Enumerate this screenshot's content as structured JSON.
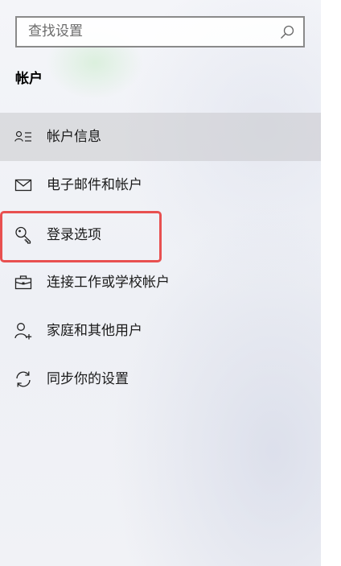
{
  "search": {
    "placeholder": "查找设置",
    "icon": "search-icon"
  },
  "section": {
    "title": "帐户"
  },
  "nav": {
    "items": [
      {
        "label": "帐户信息",
        "icon": "account-info-icon",
        "active": true
      },
      {
        "label": "电子邮件和帐户",
        "icon": "mail-icon",
        "active": false
      },
      {
        "label": "登录选项",
        "icon": "key-icon",
        "active": false,
        "highlighted": true
      },
      {
        "label": "连接工作或学校帐户",
        "icon": "briefcase-icon",
        "active": false
      },
      {
        "label": "家庭和其他用户",
        "icon": "add-person-icon",
        "active": false
      },
      {
        "label": "同步你的设置",
        "icon": "sync-icon",
        "active": false
      }
    ]
  },
  "colors": {
    "active_item_bg": "#d3d3d6",
    "highlight_border": "#e85050",
    "search_border": "#8a8a8a"
  }
}
